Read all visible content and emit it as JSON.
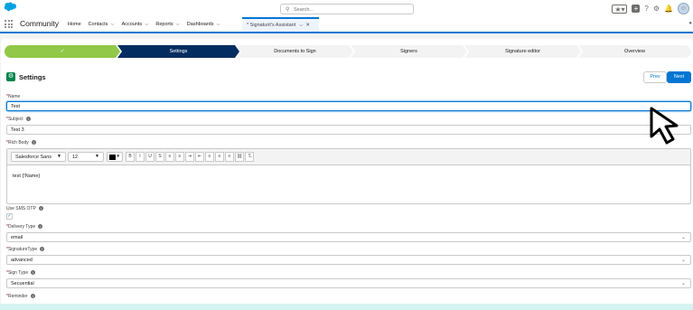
{
  "header": {
    "search_placeholder": "Search...",
    "avatar_glyph": "☺"
  },
  "nav": {
    "app_name": "Community",
    "items": [
      {
        "label": "Home",
        "has_menu": false
      },
      {
        "label": "Contacts",
        "has_menu": true
      },
      {
        "label": "Accounts",
        "has_menu": true
      },
      {
        "label": "Reports",
        "has_menu": true
      },
      {
        "label": "Dashboards",
        "has_menu": true
      }
    ],
    "active_tab": "* Signaturit's Assistant"
  },
  "path": {
    "steps": [
      {
        "label": "✓",
        "state": "done"
      },
      {
        "label": "Settings",
        "state": "current"
      },
      {
        "label": "Documents to Sign",
        "state": "todo"
      },
      {
        "label": "Signers",
        "state": "todo"
      },
      {
        "label": "Signature editor",
        "state": "todo"
      },
      {
        "label": "Overview",
        "state": "todo"
      }
    ]
  },
  "section": {
    "title": "Settings",
    "prev_label": "Prev",
    "next_label": "Next"
  },
  "form": {
    "name": {
      "label": "Name",
      "value": "Test"
    },
    "subject": {
      "label": "Subject",
      "value": "Test 3"
    },
    "rich_body": {
      "label": "Rich Body",
      "font": "Salesforce Sans",
      "size": "12",
      "text_color": "#000000",
      "content": "test {!Name}",
      "toolbar_buttons": [
        "B",
        "I",
        "U",
        "S",
        "≡",
        "≡",
        "⇥",
        "⇤",
        "≡",
        "≡",
        "≡",
        "⛓",
        "T̶"
      ]
    },
    "sms_otp": {
      "label": "Use SMS OTP",
      "checked": true
    },
    "delivery_type": {
      "label": "Delivery Type",
      "value": "email"
    },
    "signature_type": {
      "label": "SignatureType",
      "value": "advanced"
    },
    "sign_type": {
      "label": "Sign Type",
      "value": "Secuential"
    },
    "reminder": {
      "label": "Reminder"
    }
  },
  "colors": {
    "brand": "#0176d3",
    "path_done": "#91c848",
    "path_current": "#032d60",
    "section_icon": "#04844b"
  }
}
